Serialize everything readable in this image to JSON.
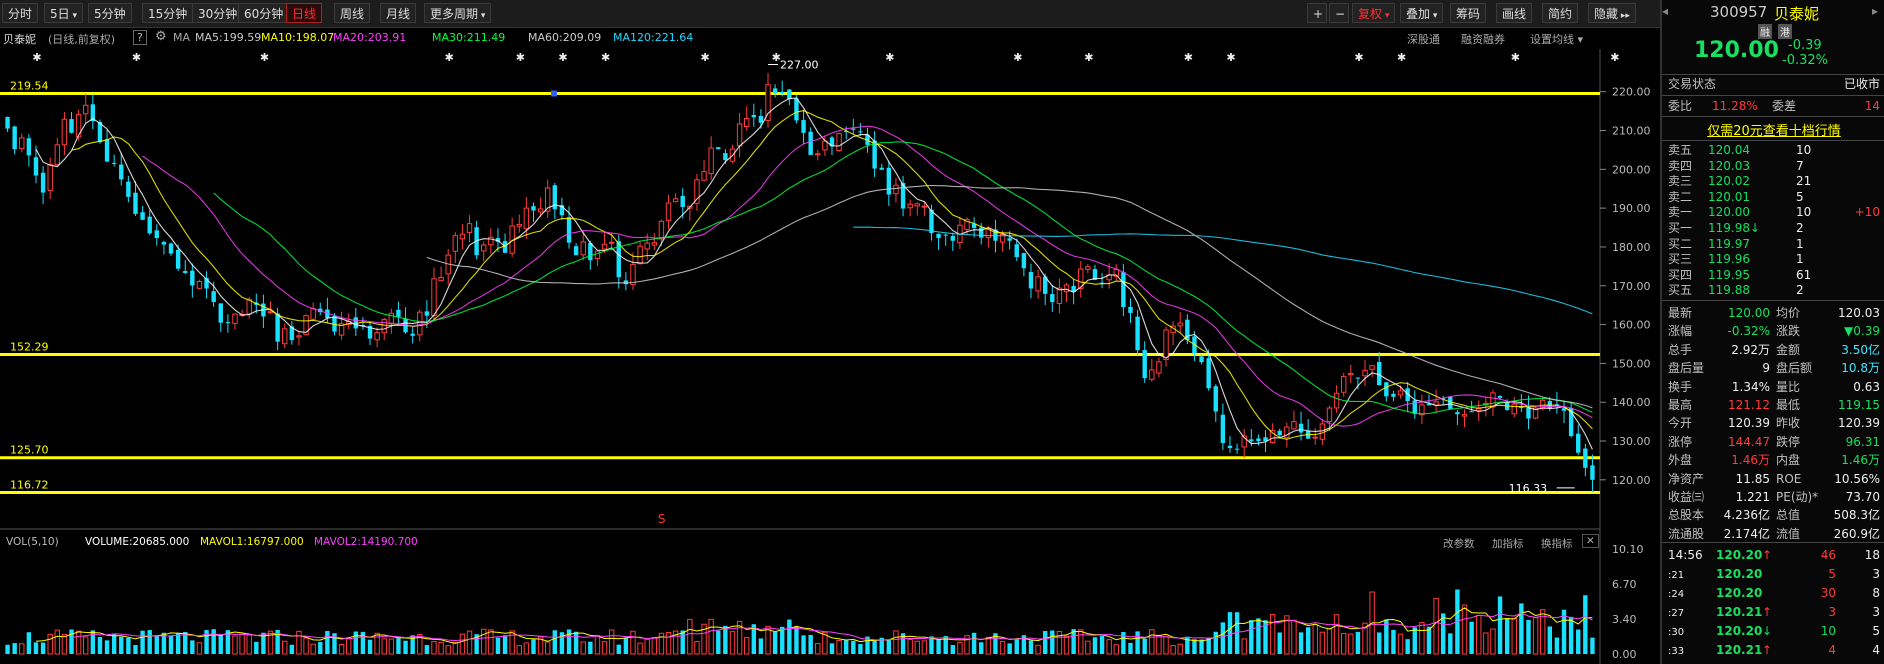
{
  "toolbar": {
    "periods": [
      "分时",
      "5日",
      "5分钟",
      "15分钟",
      "30分钟",
      "60分钟",
      "日线",
      "周线",
      "月线",
      "更多周期"
    ],
    "active_period": "日线",
    "zoom_in": "+",
    "zoom_out": "−",
    "right_buttons": [
      "复权",
      "叠加",
      "筹码",
      "画线",
      "简约",
      "隐藏"
    ]
  },
  "stock_header": {
    "name": "贝泰妮",
    "mode": "(日线,前复权)",
    "help": "?",
    "ma_label": "MA",
    "ma": [
      {
        "text": "MA5:199.59",
        "color": "#ffffff"
      },
      {
        "text": "MA10:198.07",
        "color": "#ffff00"
      },
      {
        "text": "MA20:203.91",
        "color": "#ff40ff"
      },
      {
        "text": "MA30:211.49",
        "color": "#00ff40"
      },
      {
        "text": "MA60:209.09",
        "color": "#cccccc"
      },
      {
        "text": "MA120:221.64",
        "color": "#20d8ff"
      }
    ],
    "right_links": [
      "深股通",
      "融资融券",
      "设置均线"
    ]
  },
  "levels": [
    "219.54",
    "152.29",
    "125.70",
    "116.72"
  ],
  "labels": {
    "high": "227.00",
    "low": "116.33",
    "signal": "S"
  },
  "y_axis": [
    "220.00",
    "210.00",
    "200.00",
    "190.00",
    "180.00",
    "170.00",
    "160.00",
    "150.00",
    "140.00",
    "130.00",
    "120.00"
  ],
  "volume": {
    "header": "VOL(5,10)",
    "volume": "VOLUME:20685.000",
    "mavol1": "MAVOL1:16797.000",
    "mavol2": "MAVOL2:14190.700",
    "buttons": [
      "改参数",
      "加指标",
      "换指标"
    ],
    "y_axis": [
      "10.10",
      "6.70",
      "3.40",
      "0.00"
    ]
  },
  "quote": {
    "code": "300957",
    "name": "贝泰妮",
    "badges": [
      "融",
      "港"
    ],
    "price": "120.00",
    "change": "-0.39",
    "change_pct": "-0.32%",
    "status_label": "交易状态",
    "status": "已收市",
    "weibi_label": "委比",
    "weibi": "11.28%",
    "weicha_label": "委差",
    "weicha": "14",
    "promo": "仅需20元查看十档行情",
    "asks": [
      {
        "label": "卖五",
        "price": "120.04",
        "vol": "10"
      },
      {
        "label": "卖四",
        "price": "120.03",
        "vol": "7"
      },
      {
        "label": "卖三",
        "price": "120.02",
        "vol": "21"
      },
      {
        "label": "卖二",
        "price": "120.01",
        "vol": "5"
      },
      {
        "label": "卖一",
        "price": "120.00",
        "vol": "10",
        "chg": "+10"
      }
    ],
    "bids": [
      {
        "label": "买一",
        "price": "119.98",
        "vol": "2",
        "arrow": "↓"
      },
      {
        "label": "买二",
        "price": "119.97",
        "vol": "1"
      },
      {
        "label": "买三",
        "price": "119.96",
        "vol": "1"
      },
      {
        "label": "买四",
        "price": "119.95",
        "vol": "61"
      },
      {
        "label": "买五",
        "price": "119.88",
        "vol": "2"
      }
    ],
    "stats": [
      [
        "最新",
        "120.00",
        "均价",
        "120.03"
      ],
      [
        "涨幅",
        "-0.32%",
        "涨跌",
        "▼0.39"
      ],
      [
        "总手",
        "2.92万",
        "金额",
        "3.50亿"
      ],
      [
        "盘后量",
        "9",
        "盘后额",
        "10.8万"
      ],
      [
        "换手",
        "1.34%",
        "量比",
        "0.63"
      ],
      [
        "最高",
        "121.12",
        "最低",
        "119.15"
      ],
      [
        "今开",
        "120.39",
        "昨收",
        "120.39"
      ],
      [
        "涨停",
        "144.47",
        "跌停",
        "96.31"
      ],
      [
        "外盘",
        "1.46万",
        "内盘",
        "1.46万"
      ],
      [
        "净资产",
        "11.85",
        "ROE",
        "10.56%"
      ],
      [
        "收益㈢",
        "1.221",
        "PE(动)*",
        "73.70"
      ],
      [
        "总股本",
        "4.236亿",
        "总值",
        "508.3亿"
      ],
      [
        "流通股",
        "2.174亿",
        "流值",
        "260.9亿"
      ]
    ],
    "ticks": [
      {
        "time": "14:56",
        "price": "120.20",
        "arrow": "↑",
        "vol": "46",
        "n": "18"
      },
      {
        "time": ":21",
        "price": "120.20",
        "arrow": "",
        "vol": "5",
        "n": "3"
      },
      {
        "time": ":24",
        "price": "120.20",
        "arrow": "",
        "vol": "30",
        "n": "8"
      },
      {
        "time": ":27",
        "price": "120.21",
        "arrow": "↑",
        "vol": "3",
        "n": "3"
      },
      {
        "time": ":30",
        "price": "120.20",
        "arrow": "↓",
        "vol": "10",
        "n": "5"
      },
      {
        "time": ":33",
        "price": "120.21",
        "arrow": "↑",
        "vol": "4",
        "n": "4"
      }
    ]
  },
  "colors": {
    "up": "#ff3b3b",
    "down": "#19e0ff",
    "level": "#ffff00",
    "bg": "#000000"
  },
  "chart_data": {
    "type": "candlestick",
    "ylim": [
      113,
      231
    ],
    "close": [
      210.5,
      205.2,
      208.1,
      203.6,
      198.4,
      194.0,
      201.2,
      206.3,
      212.9,
      209.4,
      214.1,
      216.5,
      212.4,
      207.0,
      202.0,
      201.4,
      197.4,
      192.9,
      188.5,
      187.0,
      183.5,
      182.3,
      180.6,
      178.3,
      174.4,
      173.3,
      170.1,
      171.1,
      169.3,
      165.8,
      160.5,
      160.6,
      162.7,
      162.6,
      166.5,
      165.1,
      162.1,
      163.4,
      155.6,
      158.9,
      156.0,
      157.1,
      162.3,
      164.1,
      163.2,
      161.7,
      158.2,
      160.2,
      160.8,
      159.0,
      159.7,
      156.4,
      157.9,
      161.3,
      162.9,
      162.0,
      158.0,
      157.1,
      163.2,
      162.3,
      171.8,
      172.1,
      177.9,
      182.9,
      183.3,
      186.0,
      177.9,
      180.5,
      182.5,
      181.3,
      178.5,
      185.4,
      185.8,
      190.0,
      189.4,
      189.8,
      195.2,
      189.7,
      188.2,
      181.1,
      177.9,
      181.3,
      176.6,
      178.9,
      180.7,
      181.2,
      172.2,
      170.4,
      175.5,
      180.2,
      181.0,
      181.1,
      186.6,
      191.3,
      192.4,
      190.3,
      190.5,
      197.3,
      199.4,
      205.5,
      205.2,
      202.4,
      205.2,
      211.7,
      213.1,
      213.4,
      212.0,
      221.8,
      219.6,
      219.6,
      218.1,
      212.6,
      209.4,
      203.7,
      204.0,
      207.3,
      205.9,
      209.2,
      209.6,
      210.2,
      209.7,
      206.3,
      200.2,
      199.9,
      193.5,
      195.9,
      189.9,
      191.0,
      191.1,
      190.5,
      183.6,
      182.3,
      183.0,
      181.6,
      185.6,
      187.1,
      184.9,
      182.4,
      184.8,
      181.6,
      183.2,
      181.6,
      177.4,
      174.5,
      169.3,
      172.3,
      167.9,
      165.8,
      169.4,
      170.2,
      168.4,
      174.3,
      174.9,
      171.5,
      170.5,
      172.8,
      174.2,
      164.5,
      163.0,
      153.4,
      146.2,
      148.3,
      150.4,
      158.6,
      159.6,
      160.4,
      156.0,
      152.6,
      150.3,
      143.6,
      137.6,
      129.5,
      128.2,
      127.8,
      131.3,
      129.9,
      130.0,
      130.0,
      132.7,
      131.5,
      133.6,
      135.0,
      132.2,
      130.6,
      131.0,
      134.4,
      138.5,
      142.3,
      146.6,
      147.4,
      146.2,
      148.2,
      149.4,
      144.4,
      141.5,
      141.4,
      142.9,
      140.3,
      137.0,
      139.3,
      139.2,
      140.1,
      140.9,
      138.3,
      136.9,
      136.8,
      137.6,
      138.4,
      139.7,
      142.4,
      141.1,
      138.0,
      139.5,
      138.5,
      135.8,
      138.5,
      140.5,
      138.5,
      139.3,
      137.8,
      131.3,
      127.0,
      123.1,
      120.0
    ],
    "horizontal_levels": [
      219.54,
      152.29,
      125.7,
      116.72
    ],
    "ma_series": [
      "MA5",
      "MA10",
      "MA20",
      "MA30",
      "MA60",
      "MA120"
    ]
  }
}
